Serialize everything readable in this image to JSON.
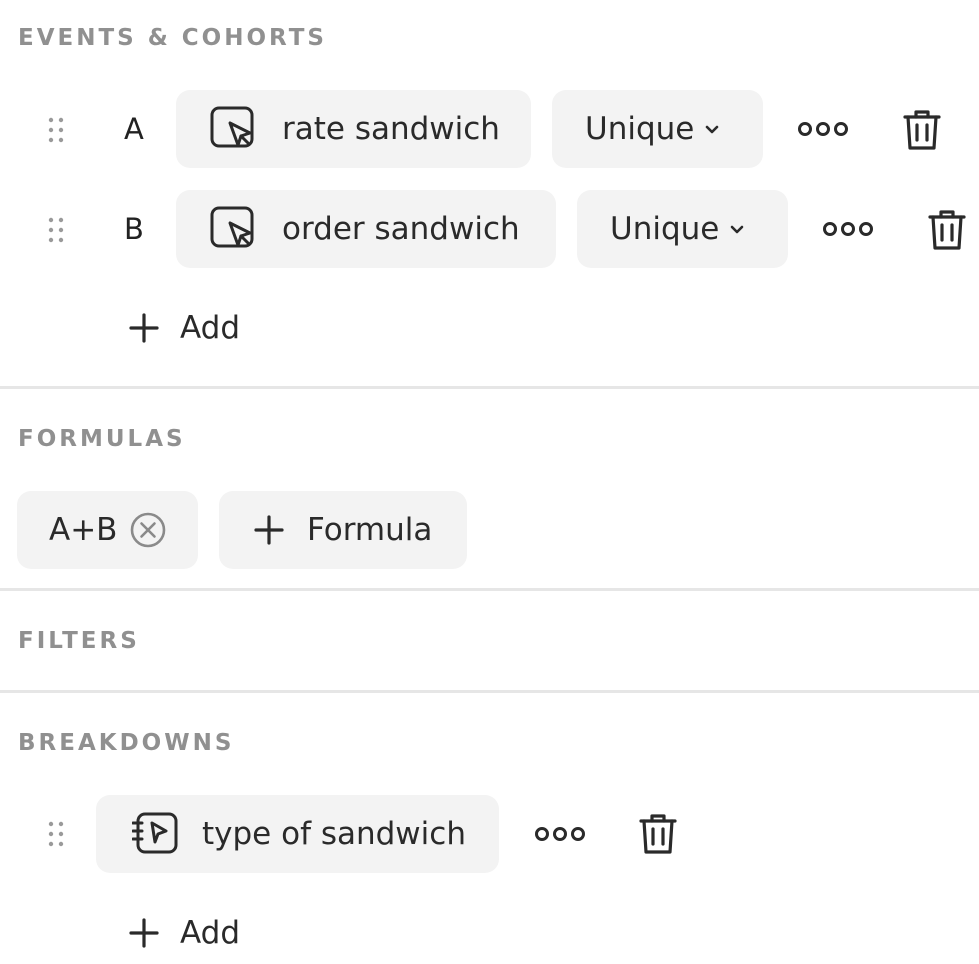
{
  "sections": {
    "events": {
      "title": "EVENTS & COHORTS",
      "items": [
        {
          "letter": "A",
          "event_name": "rate sandwich",
          "aggregation": "Unique",
          "event_icon": "event-cursor-icon"
        },
        {
          "letter": "B",
          "event_name": "order sandwich",
          "aggregation": "Unique",
          "event_icon": "event-cursor-icon"
        }
      ],
      "add_label": "Add"
    },
    "formulas": {
      "title": "FORMULAS",
      "chips": [
        {
          "label": "A+B"
        }
      ],
      "add_label": "Formula"
    },
    "filters": {
      "title": "FILTERS"
    },
    "breakdowns": {
      "title": "BREAKDOWNS",
      "items": [
        {
          "property_name": "type of sandwich",
          "property_icon": "property-cursor-icon"
        }
      ],
      "add_label": "Add"
    }
  },
  "colors": {
    "section_title": "#909090",
    "pill_background": "#f3f3f3",
    "text": "#2a2a2a",
    "divider": "#e6e6e6"
  }
}
